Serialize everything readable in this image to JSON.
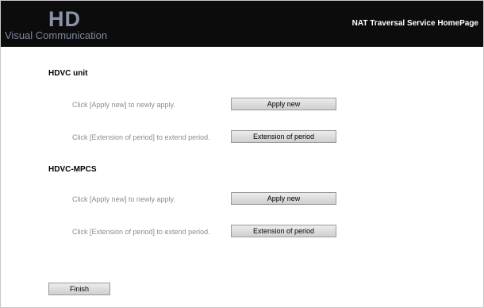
{
  "header": {
    "logo_mark": "HD",
    "logo_text": "Visual Communication",
    "title": "NAT Traversal Service HomePage"
  },
  "sections": [
    {
      "title": "HDVC unit",
      "rows": [
        {
          "instruction": "Click [Apply new] to newly apply.",
          "button": "Apply new"
        },
        {
          "instruction": "Click [Extension of period] to extend period.",
          "button": "Extension of period"
        }
      ]
    },
    {
      "title": "HDVC-MPCS",
      "rows": [
        {
          "instruction": "Click [Apply new] to newly apply.",
          "button": "Apply new"
        },
        {
          "instruction": "Click [Extension of period] to extend period.",
          "button": "Extension of period"
        }
      ]
    }
  ],
  "finish_label": "Finish"
}
